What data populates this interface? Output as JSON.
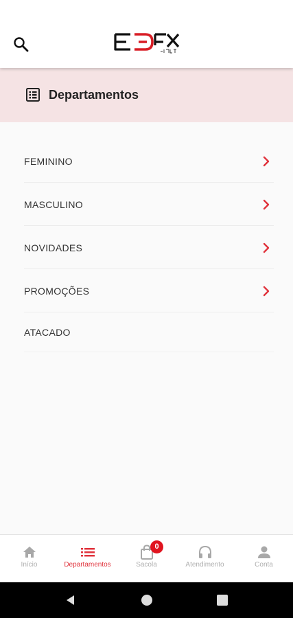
{
  "header": {
    "search_icon": "search-icon",
    "logo_text": "EDEX",
    "logo_subtext": "JEANS"
  },
  "departments": {
    "title": "Departamentos",
    "icon": "list-icon",
    "items": [
      {
        "label": "FEMININO",
        "has_arrow": true
      },
      {
        "label": "MASCULINO",
        "has_arrow": true
      },
      {
        "label": "NOVIDADES",
        "has_arrow": true
      },
      {
        "label": "PROMOÇÕES",
        "has_arrow": true
      },
      {
        "label": "ATACADO",
        "has_arrow": false
      }
    ]
  },
  "bottom_nav": {
    "items": [
      {
        "label": "Início",
        "icon": "home-icon",
        "active": false
      },
      {
        "label": "Departamentos",
        "icon": "list-icon",
        "active": true
      },
      {
        "label": "Sacola",
        "icon": "bag-icon",
        "active": false,
        "badge": "0"
      },
      {
        "label": "Atendimento",
        "icon": "headphones-icon",
        "active": false
      },
      {
        "label": "Conta",
        "icon": "user-icon",
        "active": false
      }
    ]
  },
  "colors": {
    "accent": "#e0323b",
    "header_band": "#f5e3e4",
    "background": "#fafafa"
  }
}
